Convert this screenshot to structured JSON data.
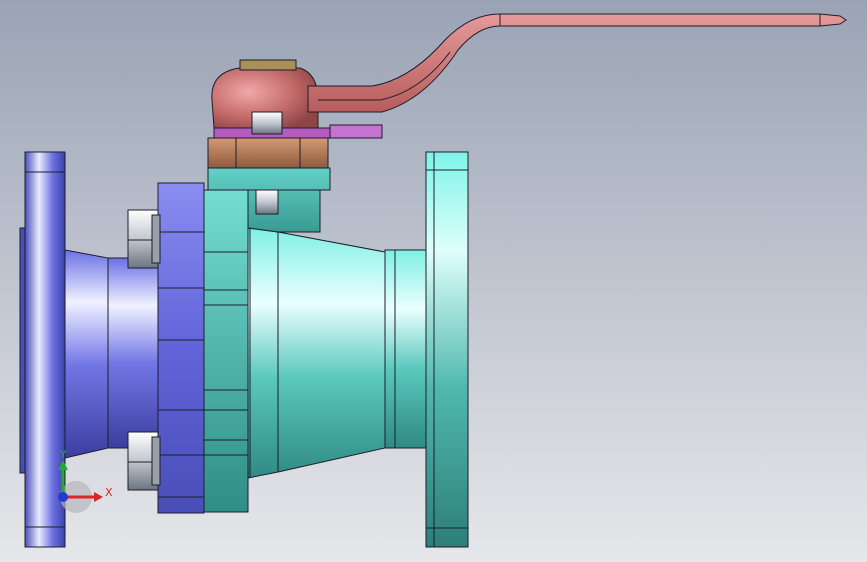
{
  "viewport": {
    "background_top": "#9aa3b5",
    "background_bottom": "#e6e7ea"
  },
  "model": {
    "parts": [
      "left-flange",
      "left-body-neck",
      "left-body-flange",
      "bolt-head-upper",
      "bolt-head-lower",
      "right-body-flange",
      "valve-body",
      "right-neck",
      "right-flange",
      "stem-neck",
      "gland-nut",
      "stem-plate",
      "handle-hub",
      "lever-handle",
      "stem-bolt"
    ],
    "colors": {
      "left_body": "#5f63d8",
      "right_body": "#58cbc0",
      "right_flange": "#5ee6da",
      "gland": "#b57b58",
      "plate": "#b45cc0",
      "handle": "#c86f6f",
      "bolt": "#b9bfc7",
      "cap": "#a99058"
    }
  },
  "triad": {
    "x_label": "X",
    "y_label": "Y",
    "x_color": "#d8262b",
    "y_color": "#25a83a",
    "z_color": "#1f3cd0"
  }
}
